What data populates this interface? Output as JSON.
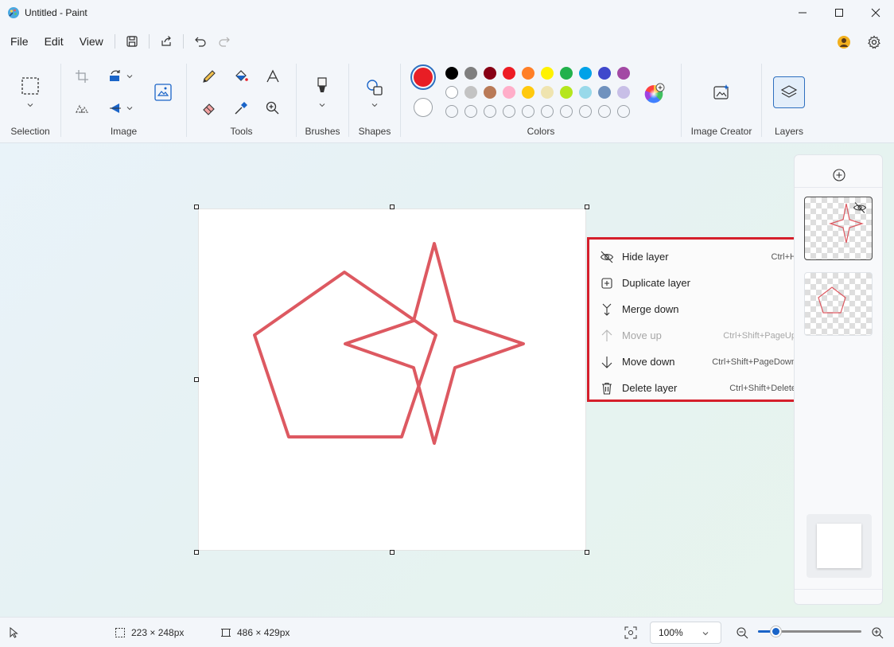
{
  "window": {
    "title": "Untitled - Paint"
  },
  "menu": {
    "items": [
      "File",
      "Edit",
      "View"
    ]
  },
  "ribbon": {
    "groups": {
      "selection": "Selection",
      "image": "Image",
      "tools": "Tools",
      "brushes": "Brushes",
      "shapes": "Shapes",
      "colors": "Colors",
      "image_creator": "Image Creator",
      "layers": "Layers"
    },
    "active_color": "#e81e25",
    "palette_row1": [
      "#000000",
      "#7f7f7f",
      "#880015",
      "#ed1c24",
      "#ff7f27",
      "#fff200",
      "#22b14c",
      "#00a2e8",
      "#3f48cc",
      "#a349a4"
    ],
    "palette_row2": [
      "#ffffff",
      "#c3c3c3",
      "#b97a57",
      "#ffaec9",
      "#ffc90e",
      "#efe4b0",
      "#b5e61d",
      "#99d9ea",
      "#7092be",
      "#c8bfe7"
    ]
  },
  "context_menu": {
    "items": [
      {
        "label": "Hide layer",
        "shortcut": "Ctrl+H",
        "icon": "eye-slash-icon"
      },
      {
        "label": "Duplicate layer",
        "shortcut": "",
        "icon": "duplicate-icon"
      },
      {
        "label": "Merge down",
        "shortcut": "",
        "icon": "merge-down-icon"
      },
      {
        "label": "Move up",
        "shortcut": "Ctrl+Shift+PageUp",
        "icon": "arrow-up-icon"
      },
      {
        "label": "Move down",
        "shortcut": "Ctrl+Shift+PageDown",
        "icon": "arrow-down-icon"
      },
      {
        "label": "Delete layer",
        "shortcut": "Ctrl+Shift+Delete",
        "icon": "trash-icon"
      }
    ]
  },
  "statusbar": {
    "selection_size": "223 × 248px",
    "canvas_size": "486 × 429px",
    "zoom": "100%",
    "zoom_slider_fraction": 0.17
  },
  "colors": {
    "accent": "#1a64c8",
    "highlight_border": "#d51f2b",
    "shape_stroke": "#dd5961"
  }
}
